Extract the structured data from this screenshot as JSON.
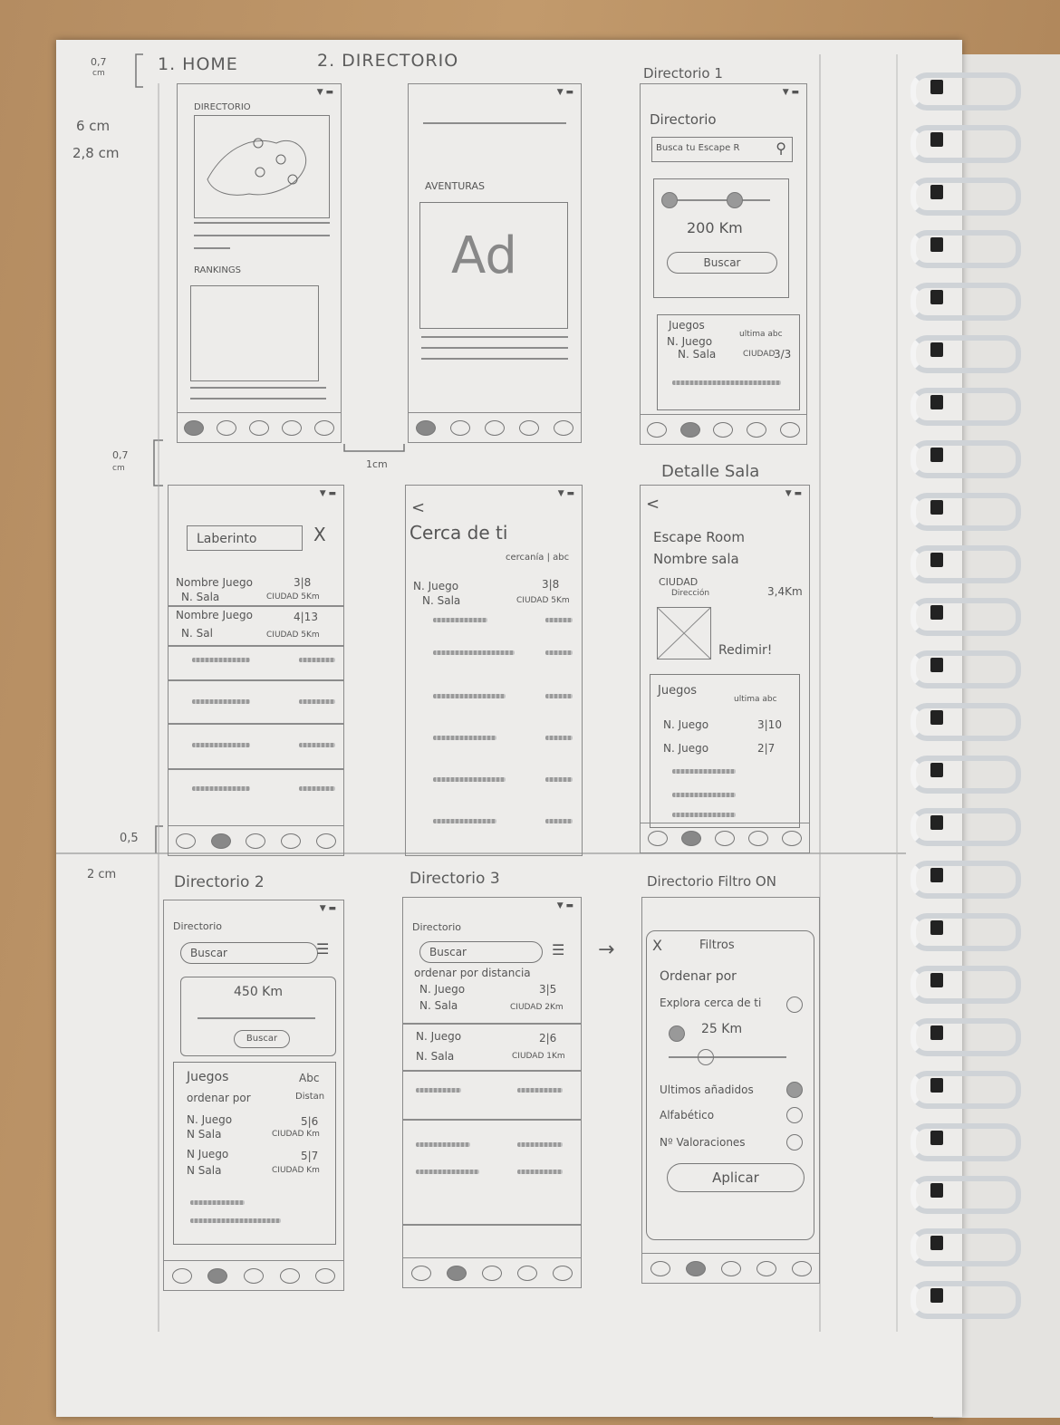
{
  "margin_notes": {
    "n1": "0,7",
    "n1b": "cm",
    "n2": "6 cm",
    "n3": "2,8 cm",
    "n4": "0,7",
    "n4b": "cm",
    "n5": "1cm",
    "n6": "0,5",
    "n7": "2 cm"
  },
  "headers": {
    "home": "1. HOME",
    "dir": "2. DIRECTORIO",
    "dir1": "Directorio 1",
    "detalle": "Detalle Sala",
    "dir2": "Directorio 2",
    "dir3": "Directorio 3",
    "filtro": "Directorio Filtro ON",
    "arrow": "→"
  },
  "home": {
    "directorio": "DIRECTORIO",
    "rankings": "RANKINGS"
  },
  "ad": {
    "aventuras": "AVENTURAS",
    "ad": "Ad"
  },
  "dir1": {
    "title": "Directorio",
    "search": "Busca tu Escape R",
    "km": "200 Km",
    "buscar": "Buscar",
    "juegos": "Juegos",
    "r1a": "N. Juego",
    "r1b": "N. Sala",
    "ultima": "ultima abc",
    "ciudad": "CIUDAD",
    "rating": "3/3"
  },
  "search": {
    "query": "Laberinto",
    "close": "X",
    "r1a": "Nombre Juego",
    "r1b": "N. Sala",
    "r1r": "3|8",
    "r1c": "CIUDAD 5Km",
    "r2a": "Nombre Juego",
    "r2b": "N. Sal",
    "r2r": "4|13",
    "r2c": "CIUDAD 5Km"
  },
  "cerca": {
    "back": "<",
    "title": "Cerca de ti",
    "sort": "cercanía | abc",
    "r1a": "N. Juego",
    "r1b": "N. Sala",
    "r1r": "3|8",
    "r1c": "CIUDAD 5Km"
  },
  "detalle": {
    "back": "<",
    "title": "Escape Room",
    "sala": "Nombre sala",
    "ciudad": "CIUDAD",
    "direccion": "Dirección",
    "dist": "3,4Km",
    "redimir": "Redimir!",
    "juegos": "Juegos",
    "ultima": "ultima abc",
    "r1a": "N. Juego",
    "r1r": "3|10",
    "r2a": "N. Juego",
    "r2r": "2|7"
  },
  "dir2": {
    "title": "Directorio",
    "search": "Buscar",
    "km": "450 Km",
    "buscar": "Buscar",
    "juegos": "Juegos",
    "abc": "Abc",
    "ordenar": "ordenar por",
    "distan": "Distan",
    "r1a": "N. Juego",
    "r1b": "N Sala",
    "r1r": "5|6",
    "r1c": "CIUDAD Km",
    "r2a": "N Juego",
    "r2b": "N Sala",
    "r2r": "5|7",
    "r2c": "CIUDAD Km"
  },
  "dir3": {
    "title": "Directorio",
    "search": "Buscar",
    "ordenar": "ordenar por distancia",
    "r1a": "N. Juego",
    "r1b": "N. Sala",
    "r1r": "3|5",
    "r1c": "CIUDAD 2Km",
    "r2a": "N. Juego",
    "r2b": "N. Sala",
    "r2r": "2|6",
    "r2c": "CIUDAD 1Km"
  },
  "filtro": {
    "close": "X",
    "title": "Filtros",
    "ordenar": "Ordenar por",
    "explora": "Explora cerca de ti",
    "km": "25 Km",
    "ultimos": "Ultimos añadidos",
    "alfa": "Alfabético",
    "valor": "Nº Valoraciones",
    "aplicar": "Aplicar"
  }
}
